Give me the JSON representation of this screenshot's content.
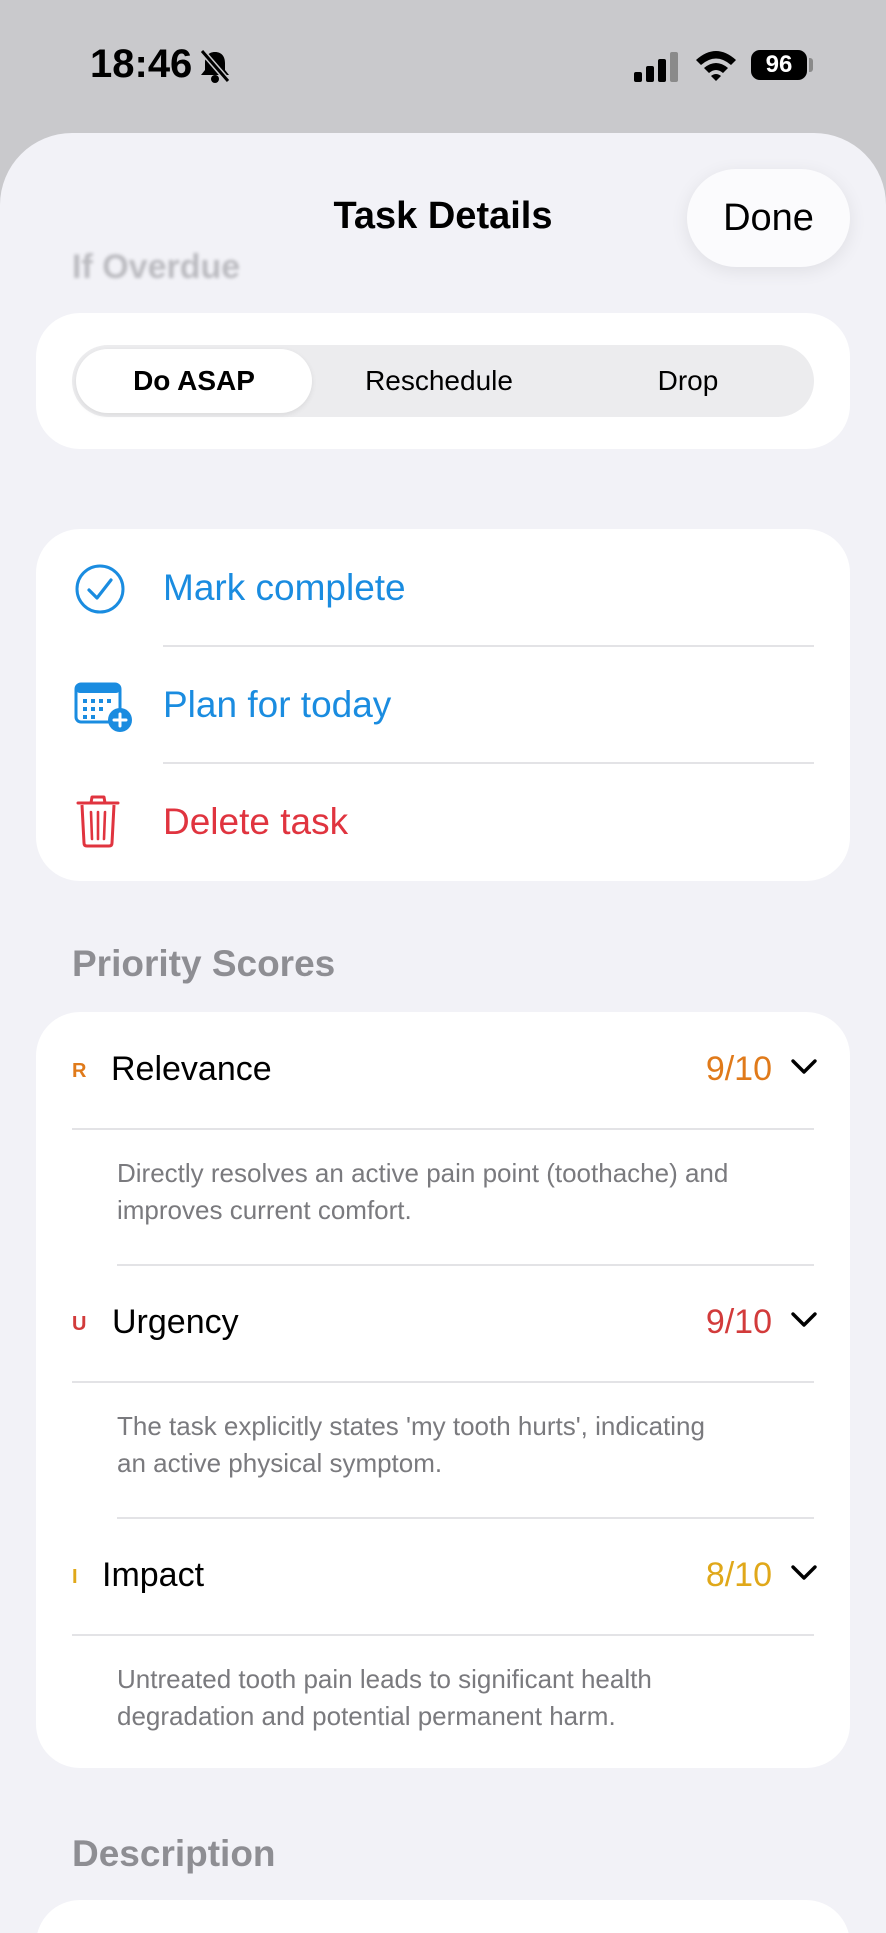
{
  "status_bar": {
    "time": "18:46",
    "battery": "96"
  },
  "sheet": {
    "title": "Task Details",
    "done_label": "Done",
    "ghost_section_label": "If Overdue"
  },
  "if_overdue": {
    "options": [
      "Do ASAP",
      "Reschedule",
      "Drop"
    ],
    "selected": "Do ASAP"
  },
  "actions": [
    {
      "label": "Mark complete",
      "icon": "checkmark-circle-icon",
      "color": "#1a8ce0"
    },
    {
      "label": "Plan for today",
      "icon": "calendar-plus-icon",
      "color": "#1a8ce0"
    },
    {
      "label": "Delete task",
      "icon": "trash-icon",
      "color": "#e0343f"
    }
  ],
  "priority_scores": {
    "label": "Priority Scores",
    "items": [
      {
        "letter": "R",
        "name": "Relevance",
        "value": "9/10",
        "color": "#e07a1a",
        "description_line1": "Directly resolves an active pain point (toothache) and",
        "description_line2": "improves current comfort."
      },
      {
        "letter": "U",
        "name": "Urgency",
        "value": "9/10",
        "color": "#d23b3b",
        "description_line1": "The task explicitly states 'my tooth hurts', indicating",
        "description_line2": "an active physical symptom."
      },
      {
        "letter": "I",
        "name": "Impact",
        "value": "8/10",
        "color": "#e0a81a",
        "description_line1": "Untreated tooth pain leads to significant health",
        "description_line2": "degradation and potential permanent harm."
      }
    ]
  },
  "description": {
    "label": "Description"
  }
}
